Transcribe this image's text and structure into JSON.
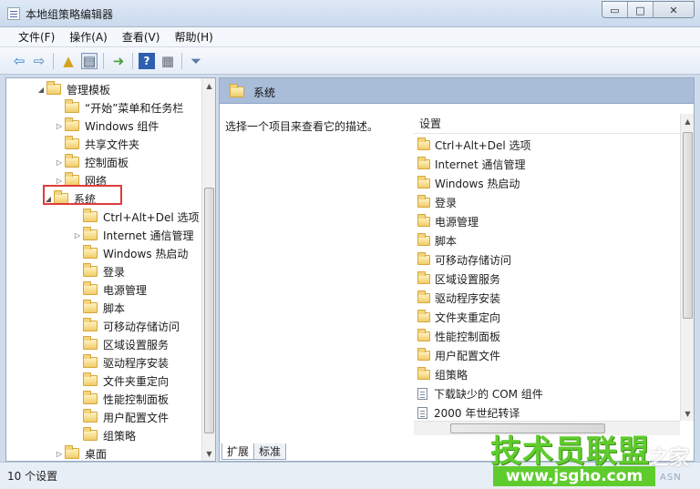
{
  "window": {
    "title": "本地组策略编辑器",
    "controls": {
      "minimize": "▭",
      "maximize": "□",
      "close": "✕"
    }
  },
  "menu": [
    "文件(F)",
    "操作(A)",
    "查看(V)",
    "帮助(H)"
  ],
  "toolbar": [
    "back-icon",
    "forward-icon",
    "up-folder-icon",
    "show-hide-tree-icon",
    "export-icon",
    "help-icon",
    "properties-icon",
    "filter-icon"
  ],
  "tree": [
    {
      "label": "管理模板",
      "arrow": "◢",
      "folder": true
    },
    {
      "label": "“开始”菜单和任务栏",
      "arrow": "",
      "folder": true
    },
    {
      "label": "Windows 组件",
      "arrow": "▷",
      "folder": true
    },
    {
      "label": "共享文件夹",
      "arrow": "",
      "folder": true
    },
    {
      "label": "控制面板",
      "arrow": "▷",
      "folder": true
    },
    {
      "label": "网络",
      "arrow": "▷",
      "folder": true
    },
    {
      "label": "系统",
      "arrow": "◢",
      "folder": true
    },
    {
      "label": "Ctrl+Alt+Del 选项",
      "arrow": "",
      "folder": true
    },
    {
      "label": "Internet 通信管理",
      "arrow": "▷",
      "folder": true
    },
    {
      "label": "Windows 热启动",
      "arrow": "",
      "folder": true
    },
    {
      "label": "登录",
      "arrow": "",
      "folder": true
    },
    {
      "label": "电源管理",
      "arrow": "",
      "folder": true
    },
    {
      "label": "脚本",
      "arrow": "",
      "folder": true
    },
    {
      "label": "可移动存储访问",
      "arrow": "",
      "folder": true
    },
    {
      "label": "区域设置服务",
      "arrow": "",
      "folder": true
    },
    {
      "label": "驱动程序安装",
      "arrow": "",
      "folder": true
    },
    {
      "label": "文件夹重定向",
      "arrow": "",
      "folder": true
    },
    {
      "label": "性能控制面板",
      "arrow": "",
      "folder": true
    },
    {
      "label": "用户配置文件",
      "arrow": "",
      "folder": true
    },
    {
      "label": "组策略",
      "arrow": "",
      "folder": true
    },
    {
      "label": "桌面",
      "arrow": "▷",
      "folder": true
    }
  ],
  "right_pane": {
    "title": "系统",
    "description": "选择一个项目来查看它的描述。",
    "column_header": "设置",
    "items": [
      {
        "label": "Ctrl+Alt+Del 选项",
        "type": "folder"
      },
      {
        "label": "Internet 通信管理",
        "type": "folder"
      },
      {
        "label": "Windows 热启动",
        "type": "folder"
      },
      {
        "label": "登录",
        "type": "folder"
      },
      {
        "label": "电源管理",
        "type": "folder"
      },
      {
        "label": "脚本",
        "type": "folder"
      },
      {
        "label": "可移动存储访问",
        "type": "folder"
      },
      {
        "label": "区域设置服务",
        "type": "folder"
      },
      {
        "label": "驱动程序安装",
        "type": "folder"
      },
      {
        "label": "文件夹重定向",
        "type": "folder"
      },
      {
        "label": "性能控制面板",
        "type": "folder"
      },
      {
        "label": "用户配置文件",
        "type": "folder"
      },
      {
        "label": "组策略",
        "type": "folder"
      },
      {
        "label": "下载缺少的 COM 组件",
        "type": "policy"
      },
      {
        "label": "2000 年世纪转译",
        "type": "policy"
      }
    ],
    "tabs": [
      "扩展",
      "标准"
    ]
  },
  "status": "10 个设置",
  "watermark": {
    "title": "技术员联盟",
    "home": "之家",
    "url": "www.jsgho.com",
    "small": "ASN"
  }
}
